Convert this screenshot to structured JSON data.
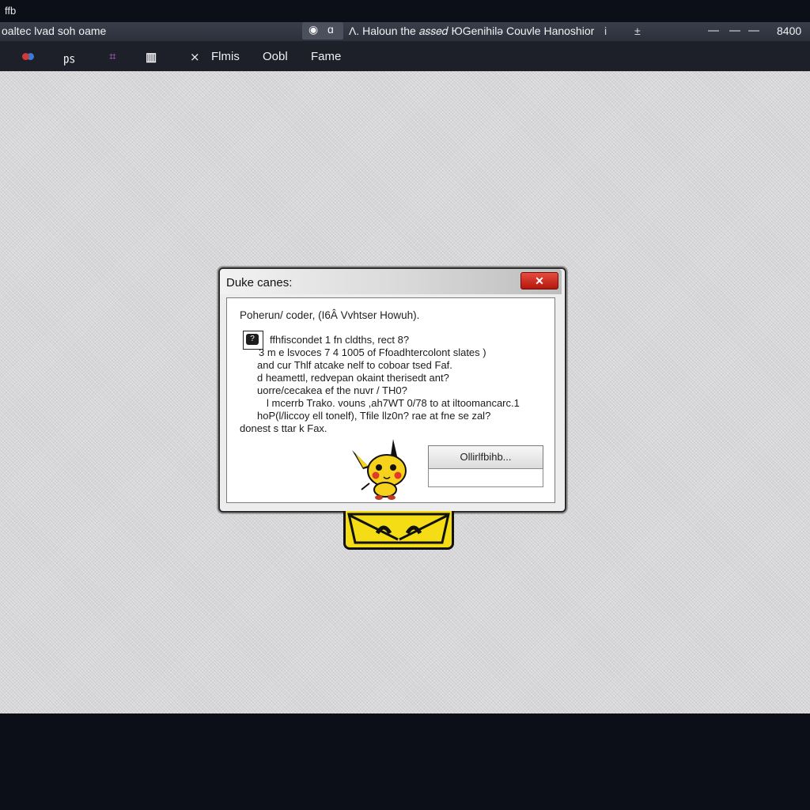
{
  "topstrip": {
    "corner_text": "ffb"
  },
  "titlebar": {
    "left_title": "oaltec lvad soh oame",
    "url_text": "Ʌ. Haloun the 𝑎𝑠𝑠𝑒𝑑 ЮGenihilǝ Couvle Hanoshior",
    "misc_1": "i",
    "misc_2": "±",
    "right_number": "8400"
  },
  "toolbar": {
    "item_1": "㎰",
    "item_2": "⨯",
    "item_3": "Flmis",
    "item_4": "Oobl",
    "item_5": "Fame"
  },
  "dialog": {
    "title": "Duke canes:",
    "close_symbol": "✕",
    "headline": "Poherun/ coder, (I6Â Vvhtser Howuh).",
    "icon_glyph": "?",
    "lines": [
      "ffhfiscondet 1 fn cldths, rect 8?",
      "3 m e lsvoces 7 4 1005 of Ffoadhtercolont slates )",
      "and cur Thlf atcake nelf to coboar tsed Faf.",
      "d heamettl, redvepan okaint therisedt ant?",
      "uorre/cecakea ef the nuvr / TH0?",
      "l mcerrb Trako. vouns ,ah7WT 0/78 to at iltoomancarc.1",
      "hoP(l/liccoy ell tonelf), Tfile llz0n? rae at fne se zal?",
      "donest s ttar k Fax."
    ],
    "button_primary": "Ollirlfbihb..."
  },
  "colors": {
    "close_red": "#d9342a",
    "plate_yellow": "#f4dd14",
    "desktop_grey": "#d6d6d9",
    "chrome_dark": "#1d2029"
  }
}
